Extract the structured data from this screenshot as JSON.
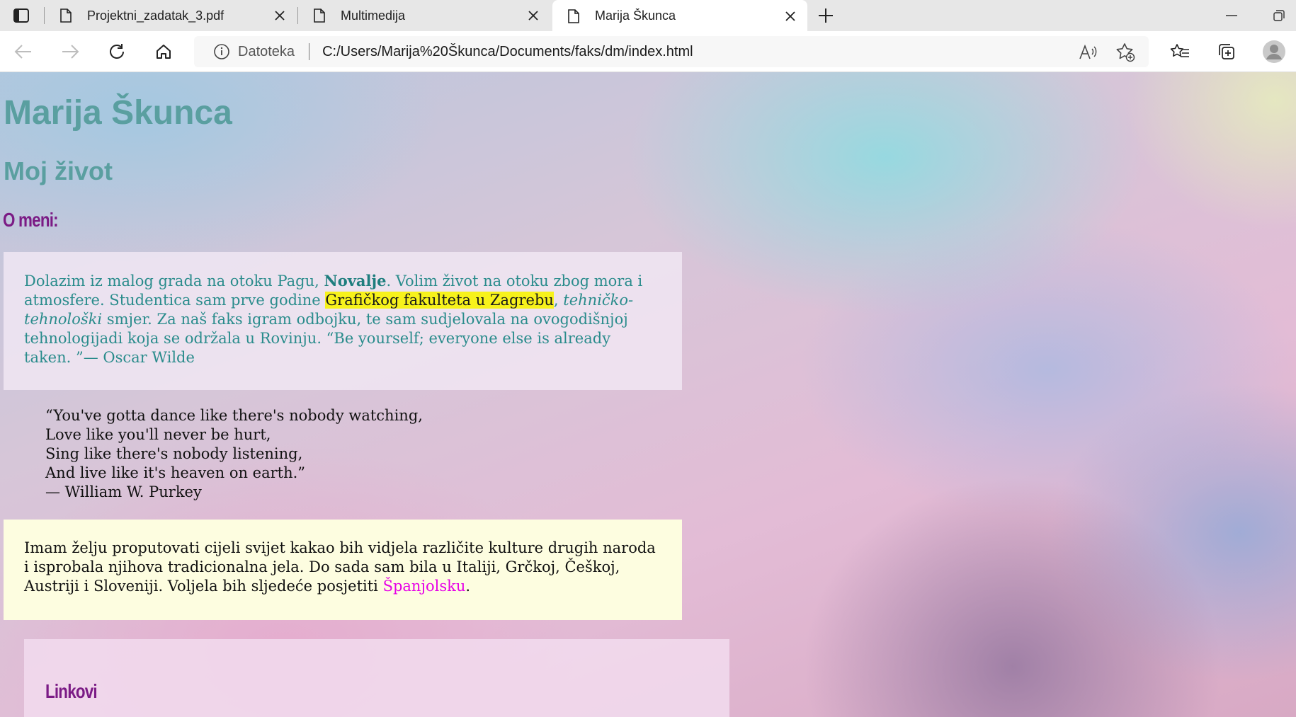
{
  "browser": {
    "tabs": [
      {
        "title": "Projektni_zadatak_3.pdf",
        "active": false
      },
      {
        "title": "Multimedija",
        "active": false
      },
      {
        "title": "Marija Škunca",
        "active": true
      }
    ],
    "address": {
      "protocol_label": "Datoteka",
      "url": "C:/Users/Marija%20Škunca/Documents/faks/dm/index.html"
    }
  },
  "page": {
    "title": "Marija Škunca",
    "subtitle": "Moj život",
    "about_heading": "O meni:",
    "about": {
      "t1": "Dolazim iz malog grada na otoku Pagu, ",
      "bold": "Novalje",
      "t2": ". Volim život na otoku zbog mora i atmosfere. Studentica sam prve godine ",
      "highlight": "Grafičkog fakulteta u Zagrebu",
      "t3": ", ",
      "italic": "tehničko-tehnološki",
      "t4": " smjer. Za naš faks igram odbojku, te sam sudjelovala na ovogodišnjoj tehnologijadi koja se održala u Rovinju. “Be yourself; everyone else is already taken. ”— Oscar Wilde"
    },
    "quote_lines": [
      "“You've gotta dance like there's nobody watching,",
      "Love like you'll never be hurt,",
      "Sing like there's nobody listening,",
      "And live like it's heaven on earth.”",
      "— William W. Purkey"
    ],
    "travel": {
      "text": "Imam želju proputovati cijeli svijet kakao bih vidjela različite kulture drugih naroda i isprobala njihova tradicionalna jela. Do sada sam bila u Italiji, Grčkoj, Češkoj, Austriji i Sloveniji. Voljela bih sljedeće posjetiti ",
      "link": "Španjolsku",
      "end": "."
    },
    "links_heading": "Linkovi"
  },
  "colors": {
    "heading_teal": "#5a9fa0",
    "heading_purple": "#7b1b85",
    "about_text": "#2a8c8c",
    "highlight": "#f7f21c",
    "link": "#e600e6"
  }
}
